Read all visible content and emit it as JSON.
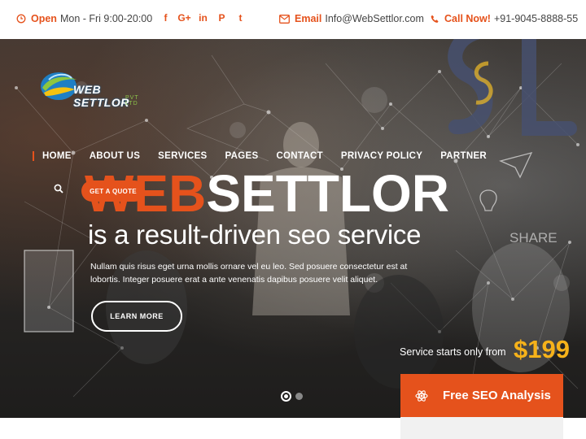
{
  "topbar": {
    "open_label": "Open",
    "hours": "Mon - Fri 9:00-20:00",
    "social": [
      {
        "icon": "facebook-icon",
        "glyph": "f"
      },
      {
        "icon": "google-plus-icon",
        "glyph": "G+"
      },
      {
        "icon": "linkedin-icon",
        "glyph": "in"
      },
      {
        "icon": "pinterest-icon",
        "glyph": "P"
      },
      {
        "icon": "twitter-icon",
        "glyph": "t"
      }
    ],
    "email_label": "Email",
    "email": "Info@WebSettlor.com",
    "call_label": "Call Now!",
    "phone": "+91-9045-8888-55"
  },
  "logo": {
    "text": "WEB SETTLOR",
    "sub": "PVT LTD"
  },
  "nav": {
    "items": [
      "HOME",
      "ABOUT US",
      "SERVICES",
      "PAGES",
      "CONTACT",
      "PRIVACY POLICY",
      "PARTNER"
    ],
    "quote_button": "GET A QUOTE"
  },
  "hero": {
    "headline_accent": "WEB",
    "headline_rest": "SETTLOR",
    "subheadline": "is a result-driven seo service",
    "paragraph": "Nullam quis risus eget urna mollis ornare vel eu leo. Sed posuere consectetur est at lobortis. Integer posuere erat a ante venenatis dapibus posuere velit aliquet.",
    "learn_more": "LEARN MORE",
    "price_label": "Service starts only from",
    "price": "$199",
    "free_seo": "Free SEO Analysis",
    "slide_count": 2,
    "active_slide": 1
  },
  "colors": {
    "accent": "#e5521c",
    "price": "#f6b21a"
  }
}
